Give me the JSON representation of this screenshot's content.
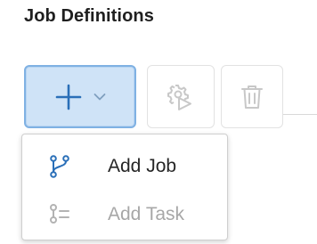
{
  "header": {
    "title": "Job Definitions"
  },
  "toolbar": {
    "add_button_icon": "plus-icon",
    "add_dropdown_icon": "chevron-down-icon",
    "run_button_icon": "gear-run-icon",
    "delete_button_icon": "trash-icon"
  },
  "dropdown": {
    "items": [
      {
        "label": "Add Job",
        "icon": "branch-icon",
        "enabled": true
      },
      {
        "label": "Add Task",
        "icon": "task-list-icon",
        "enabled": false
      }
    ]
  },
  "colors": {
    "accent": "#2a6fb8",
    "accent_bg": "#cfe3f7",
    "accent_border": "#7fb1e3",
    "disabled": "#a7a7a7",
    "disabled_icon": "#c8c8c8"
  }
}
